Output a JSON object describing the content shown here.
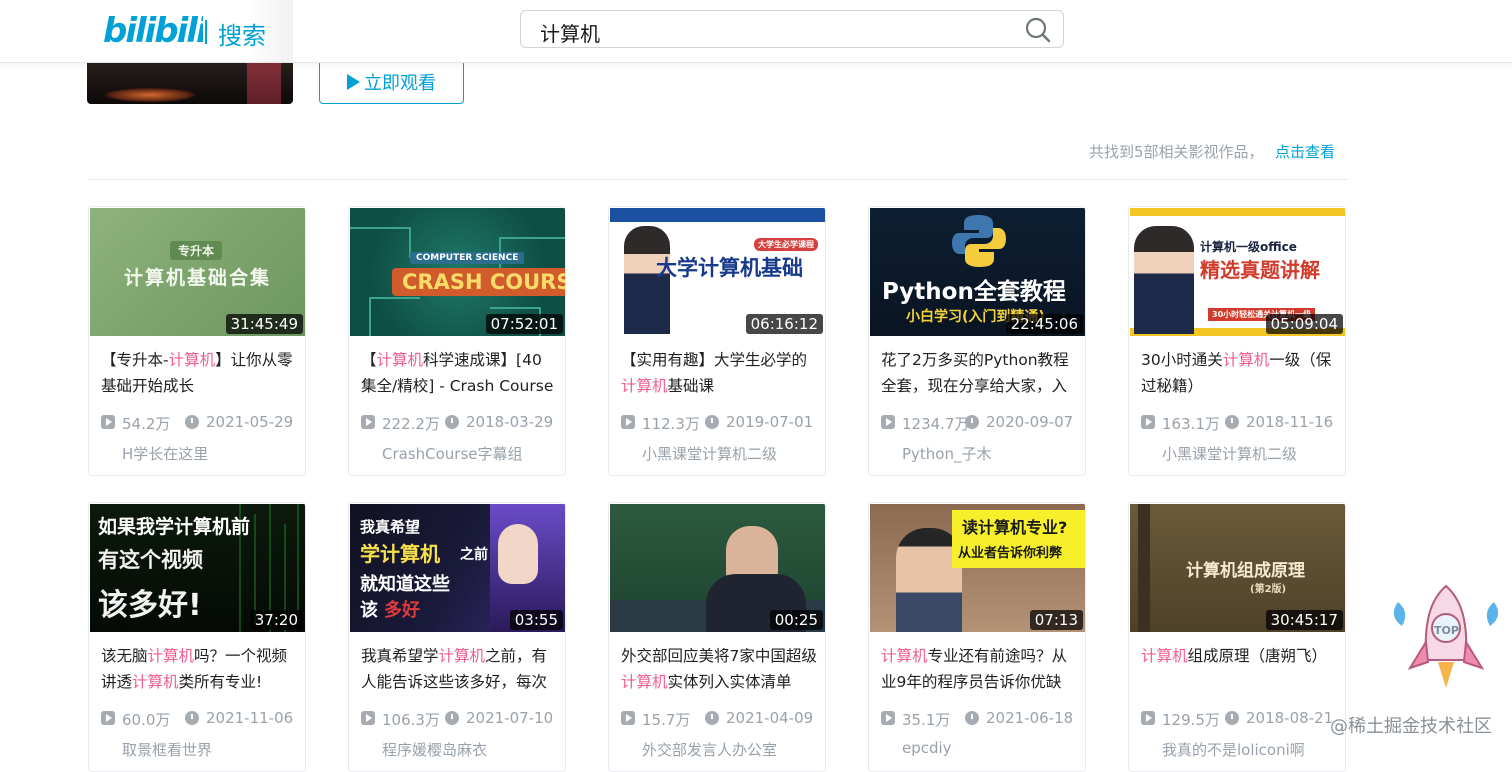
{
  "header": {
    "logo_text": "bilibili",
    "logo_section": "搜索",
    "search_value": "计算机"
  },
  "banner": {
    "watch_label": "立即观看"
  },
  "results_info": {
    "found_text": "共找到5部相关影视作品，",
    "link_label": "点击查看"
  },
  "videos": [
    {
      "duration": "31:45:49",
      "title_parts": [
        "【专升本-",
        "计算机",
        "】让你从零基础开始成长"
      ],
      "views": "54.2万",
      "date": "2021-05-29",
      "uploader": "H学长在这里",
      "thumb_text": [
        "专升本",
        "计算机基础合集"
      ]
    },
    {
      "duration": "07:52:01",
      "title_parts": [
        "【",
        "计算机",
        "科学速成课】[40集全/精校] - Crash Course"
      ],
      "views": "222.2万",
      "date": "2018-03-29",
      "uploader": "CrashCourse字幕组",
      "thumb_text": [
        "CRASH COURSE",
        "COMPUTER SCIENCE"
      ]
    },
    {
      "duration": "06:16:12",
      "title_parts": [
        "【实用有趣】大学生必学的",
        "计算机",
        "基础课"
      ],
      "views": "112.3万",
      "date": "2019-07-01",
      "uploader": "小黑课堂计算机二级",
      "thumb_text": [
        "大学计算机基础",
        "大学生必学课程"
      ]
    },
    {
      "duration": "22:45:06",
      "title_parts": [
        "花了2万多买的Python教程全套，现在分享给大家，入",
        "",
        ""
      ],
      "views": "1234.7万",
      "date": "2020-09-07",
      "uploader": "Python_子木",
      "thumb_text": [
        "Python全套教程",
        "小白学习(入门到精通)"
      ]
    },
    {
      "duration": "05:09:04",
      "title_parts": [
        "30小时通关",
        "计算机",
        "一级（保过秘籍）"
      ],
      "views": "163.1万",
      "date": "2018-11-16",
      "uploader": "小黑课堂计算机二级",
      "thumb_text": [
        "计算机一级office",
        "精选真题讲解",
        "30小时轻松通关计算机一级"
      ]
    },
    {
      "duration": "37:20",
      "title_parts": [
        "该无脑",
        "计算机",
        "吗？一个视频讲透",
        "计算机",
        "类所有专业!"
      ],
      "views": "60.0万",
      "date": "2021-11-06",
      "uploader": "取景框看世界",
      "thumb_text": [
        "如果我学计算机前",
        "有这个视频",
        "该多好!"
      ]
    },
    {
      "duration": "03:55",
      "title_parts": [
        "我真希望学",
        "计算机",
        "之前，有人能告诉这些该多好，每次"
      ],
      "views": "106.3万",
      "date": "2021-07-10",
      "uploader": "程序媛樱岛麻衣",
      "thumb_text": [
        "我真希望",
        "学计算机",
        "之前",
        "就知道这些",
        "该",
        "多好"
      ]
    },
    {
      "duration": "00:25",
      "title_parts": [
        "外交部回应美将7家中国超级",
        "计算机",
        "实体列入实体清单"
      ],
      "views": "15.7万",
      "date": "2021-04-09",
      "uploader": "外交部发言人办公室",
      "thumb_text": []
    },
    {
      "duration": "07:13",
      "title_parts": [
        "",
        "计算机",
        "专业还有前途吗？从业9年的程序员告诉你优缺"
      ],
      "views": "35.1万",
      "date": "2021-06-18",
      "uploader": "epcdiy",
      "thumb_text": [
        "读计算机专业?",
        "从业者告诉你利弊"
      ]
    },
    {
      "duration": "30:45:17",
      "title_parts": [
        "",
        "计算机",
        "组成原理（唐朔飞）"
      ],
      "views": "129.5万",
      "date": "2018-08-21",
      "uploader": "我真的不是loliconi啊",
      "thumb_text": [
        "计算机组成原理",
        "(第2版)"
      ]
    }
  ],
  "floating": {
    "top_label": "TOP",
    "watermark": "@稀土掘金技术社区"
  },
  "colors": {
    "brand": "#00a1d6",
    "highlight": "#f25d8e",
    "meta": "#99a2aa"
  }
}
